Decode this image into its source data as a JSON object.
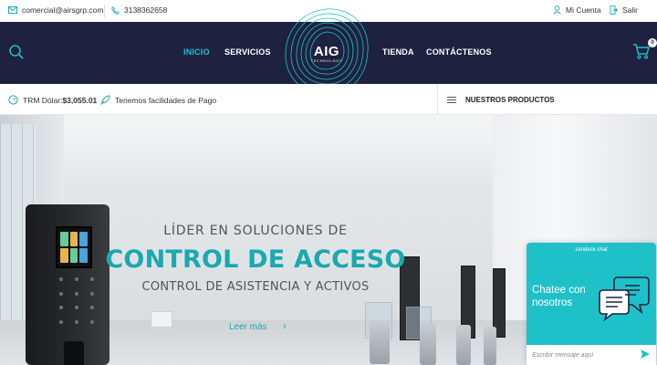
{
  "topbar": {
    "email": "comercial@airsgrp.com",
    "phone": "3138362658",
    "account": "Mi Cuenta",
    "logout": "Salir"
  },
  "nav": {
    "links": [
      "INICIO",
      "SERVICIOS",
      "TIENDA",
      "CONTÁCTENOS"
    ],
    "logo_text": "AIG",
    "logo_sub": "TECHNOLOGY",
    "cart_count": "0"
  },
  "infobar": {
    "trm_label": "TRM Dólar:",
    "trm_value": "$3,055.01",
    "payment": "Tenemos facilidades de Pago",
    "products": "NUESTROS PRODUCTOS"
  },
  "hero": {
    "line1": "LÍDER EN SOLUCIONES DE",
    "line2": "CONTROL DE ACCESO",
    "line3": "CONTROL DE ASISTENCIA Y ACTIVOS",
    "more": "Leer más"
  },
  "chat": {
    "brand": "zendesk chat",
    "message": "Chatee con nosotros",
    "placeholder": "Escribir mensaje aquí"
  },
  "colors": {
    "nav_bg": "#1e2240",
    "accent": "#1aa9b0",
    "chat_bg": "#1fc1c9"
  }
}
